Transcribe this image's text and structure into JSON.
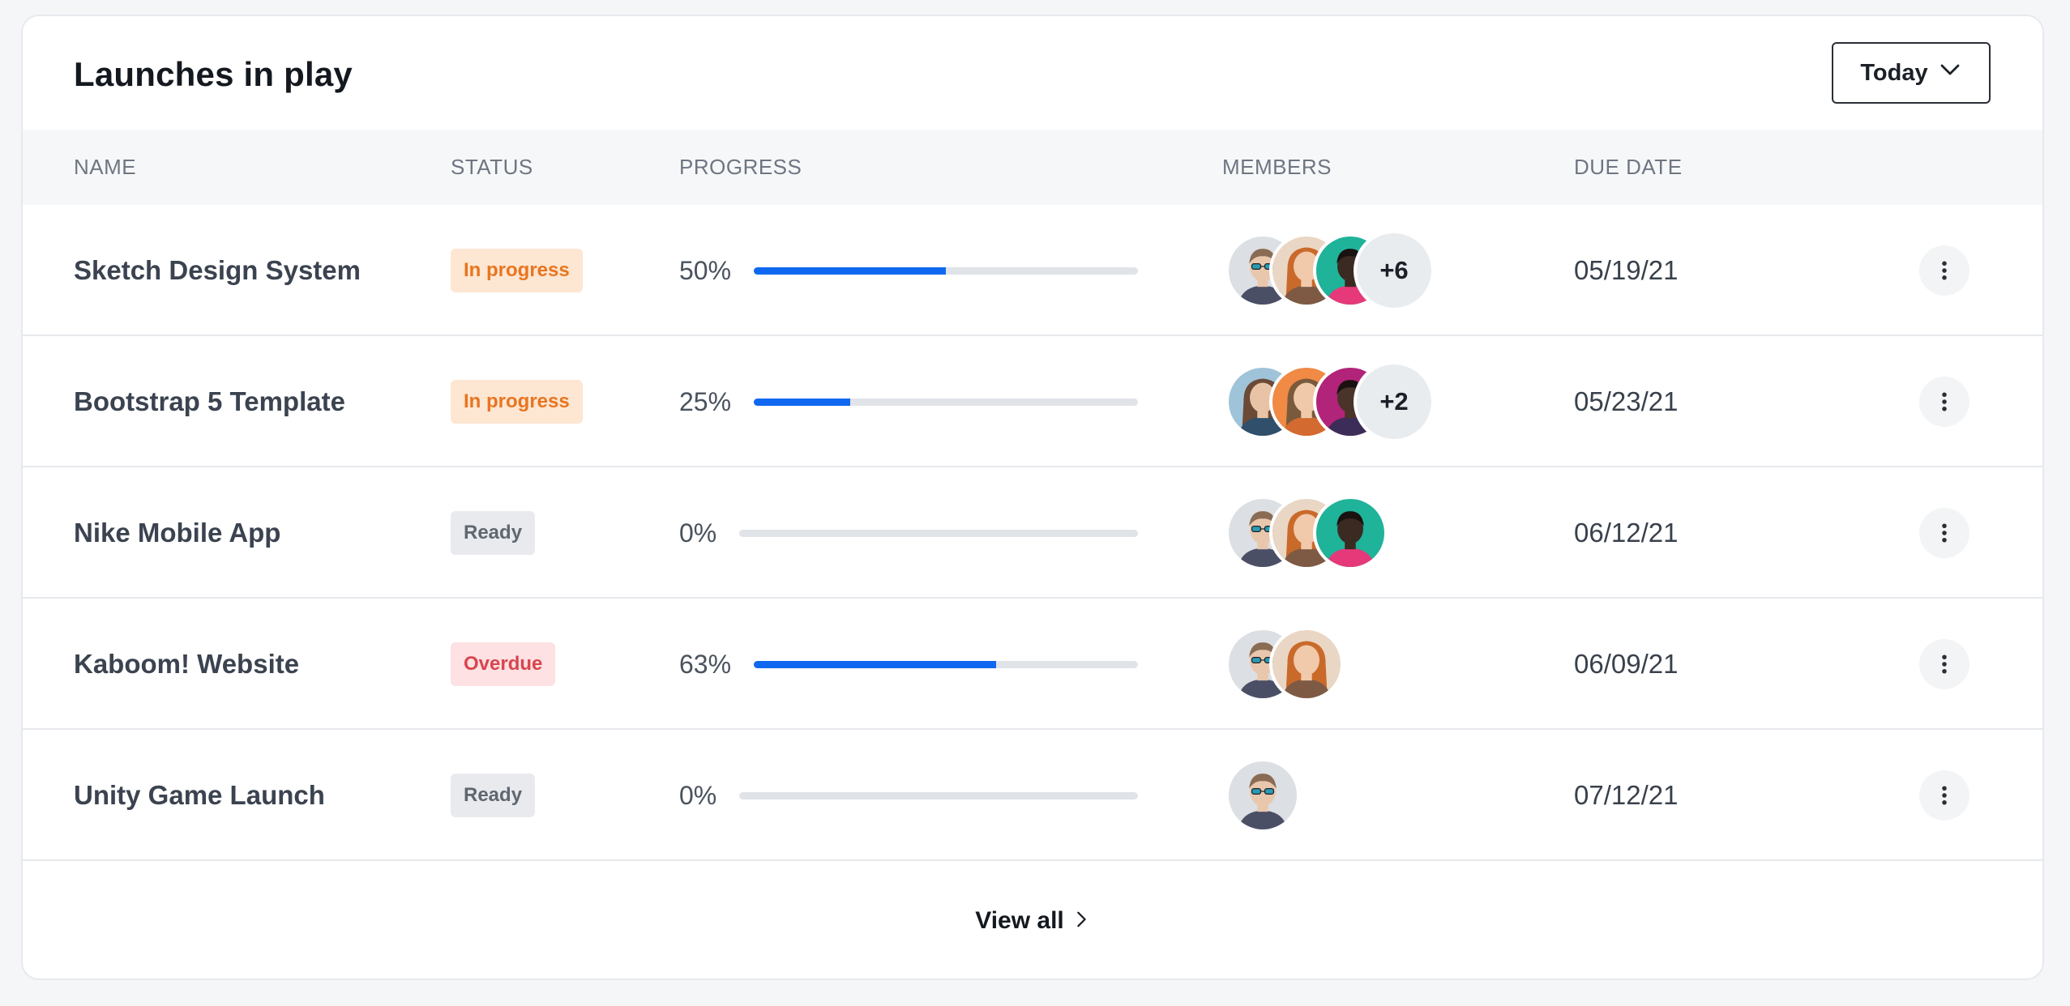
{
  "card": {
    "title": "Launches in play",
    "period_label": "Today",
    "view_all_label": "View all"
  },
  "columns": {
    "name": "NAME",
    "status": "STATUS",
    "progress": "PROGRESS",
    "members": "MEMBERS",
    "due": "DUE DATE"
  },
  "rows": [
    {
      "name": "Sketch Design System",
      "status": "In progress",
      "status_kind": "inprogress",
      "progress_label": "50%",
      "progress": 0.5,
      "avatars": [
        "man-glasses",
        "woman-red",
        "man-dark"
      ],
      "more": "+6",
      "due": "05/19/21"
    },
    {
      "name": "Bootstrap 5 Template",
      "status": "In progress",
      "status_kind": "inprogress",
      "progress_label": "25%",
      "progress": 0.25,
      "avatars": [
        "woman-blue",
        "woman-orange",
        "man-pink"
      ],
      "more": "+2",
      "due": "05/23/21"
    },
    {
      "name": "Nike Mobile App",
      "status": "Ready",
      "status_kind": "ready",
      "progress_label": "0%",
      "progress": 0.0,
      "avatars": [
        "man-glasses",
        "woman-red",
        "man-dark"
      ],
      "more": "",
      "due": "06/12/21"
    },
    {
      "name": "Kaboom! Website",
      "status": "Overdue",
      "status_kind": "overdue",
      "progress_label": "63%",
      "progress": 0.63,
      "avatars": [
        "man-glasses",
        "woman-red"
      ],
      "more": "",
      "due": "06/09/21"
    },
    {
      "name": "Unity Game Launch",
      "status": "Ready",
      "status_kind": "ready",
      "progress_label": "0%",
      "progress": 0.0,
      "avatars": [
        "man-glasses"
      ],
      "more": "",
      "due": "07/12/21"
    }
  ],
  "icons": {
    "period_dropdown": "chevron-down-icon",
    "row_action": "kebab-menu-icon",
    "view_all": "chevron-right-icon"
  },
  "colors": {
    "accent": "#1068f0",
    "in_progress_bg": "#fde6d2",
    "in_progress_fg": "#e8751f",
    "ready_bg": "#e8eaed",
    "ready_fg": "#5f6771",
    "overdue_bg": "#fde1e3",
    "overdue_fg": "#d9454f"
  }
}
